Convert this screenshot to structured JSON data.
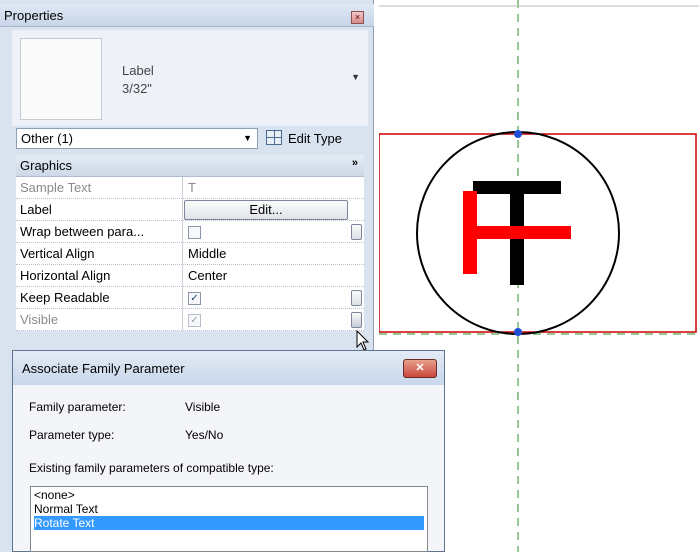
{
  "properties": {
    "title": "Properties",
    "type_selector": {
      "name": "Label",
      "size": "3/32\""
    },
    "filter": {
      "value": "Other (1)"
    },
    "edit_type_label": "Edit Type",
    "section": {
      "title": "Graphics",
      "chevron": "»"
    },
    "rows": [
      {
        "label": "Sample Text",
        "value": "T",
        "disabled": true
      },
      {
        "label": "Label",
        "button": "Edit..."
      },
      {
        "label": "Wrap between para...",
        "checkbox": false
      },
      {
        "label": "Vertical Align",
        "value": "Middle"
      },
      {
        "label": "Horizontal Align",
        "value": "Center"
      },
      {
        "label": "Keep Readable",
        "checkbox": true
      },
      {
        "label": "Visible",
        "checkbox": true,
        "disabled": true
      }
    ]
  },
  "dialog": {
    "title": "Associate Family Parameter",
    "family_parameter_label": "Family parameter:",
    "family_parameter_value": "Visible",
    "parameter_type_label": "Parameter type:",
    "parameter_type_value": "Yes/No",
    "existing_label": "Existing family parameters of compatible type:",
    "list": [
      "<none>",
      "Normal Text",
      "Rotate Text"
    ],
    "selected_index": 2
  },
  "canvas": {
    "colors": {
      "box": "#cc0000",
      "ref_line": "#2e8b2e",
      "circle": "#000000",
      "red_glyph": "#ff0000",
      "black_glyph": "#000000",
      "grip": "#1f4fd6"
    }
  }
}
